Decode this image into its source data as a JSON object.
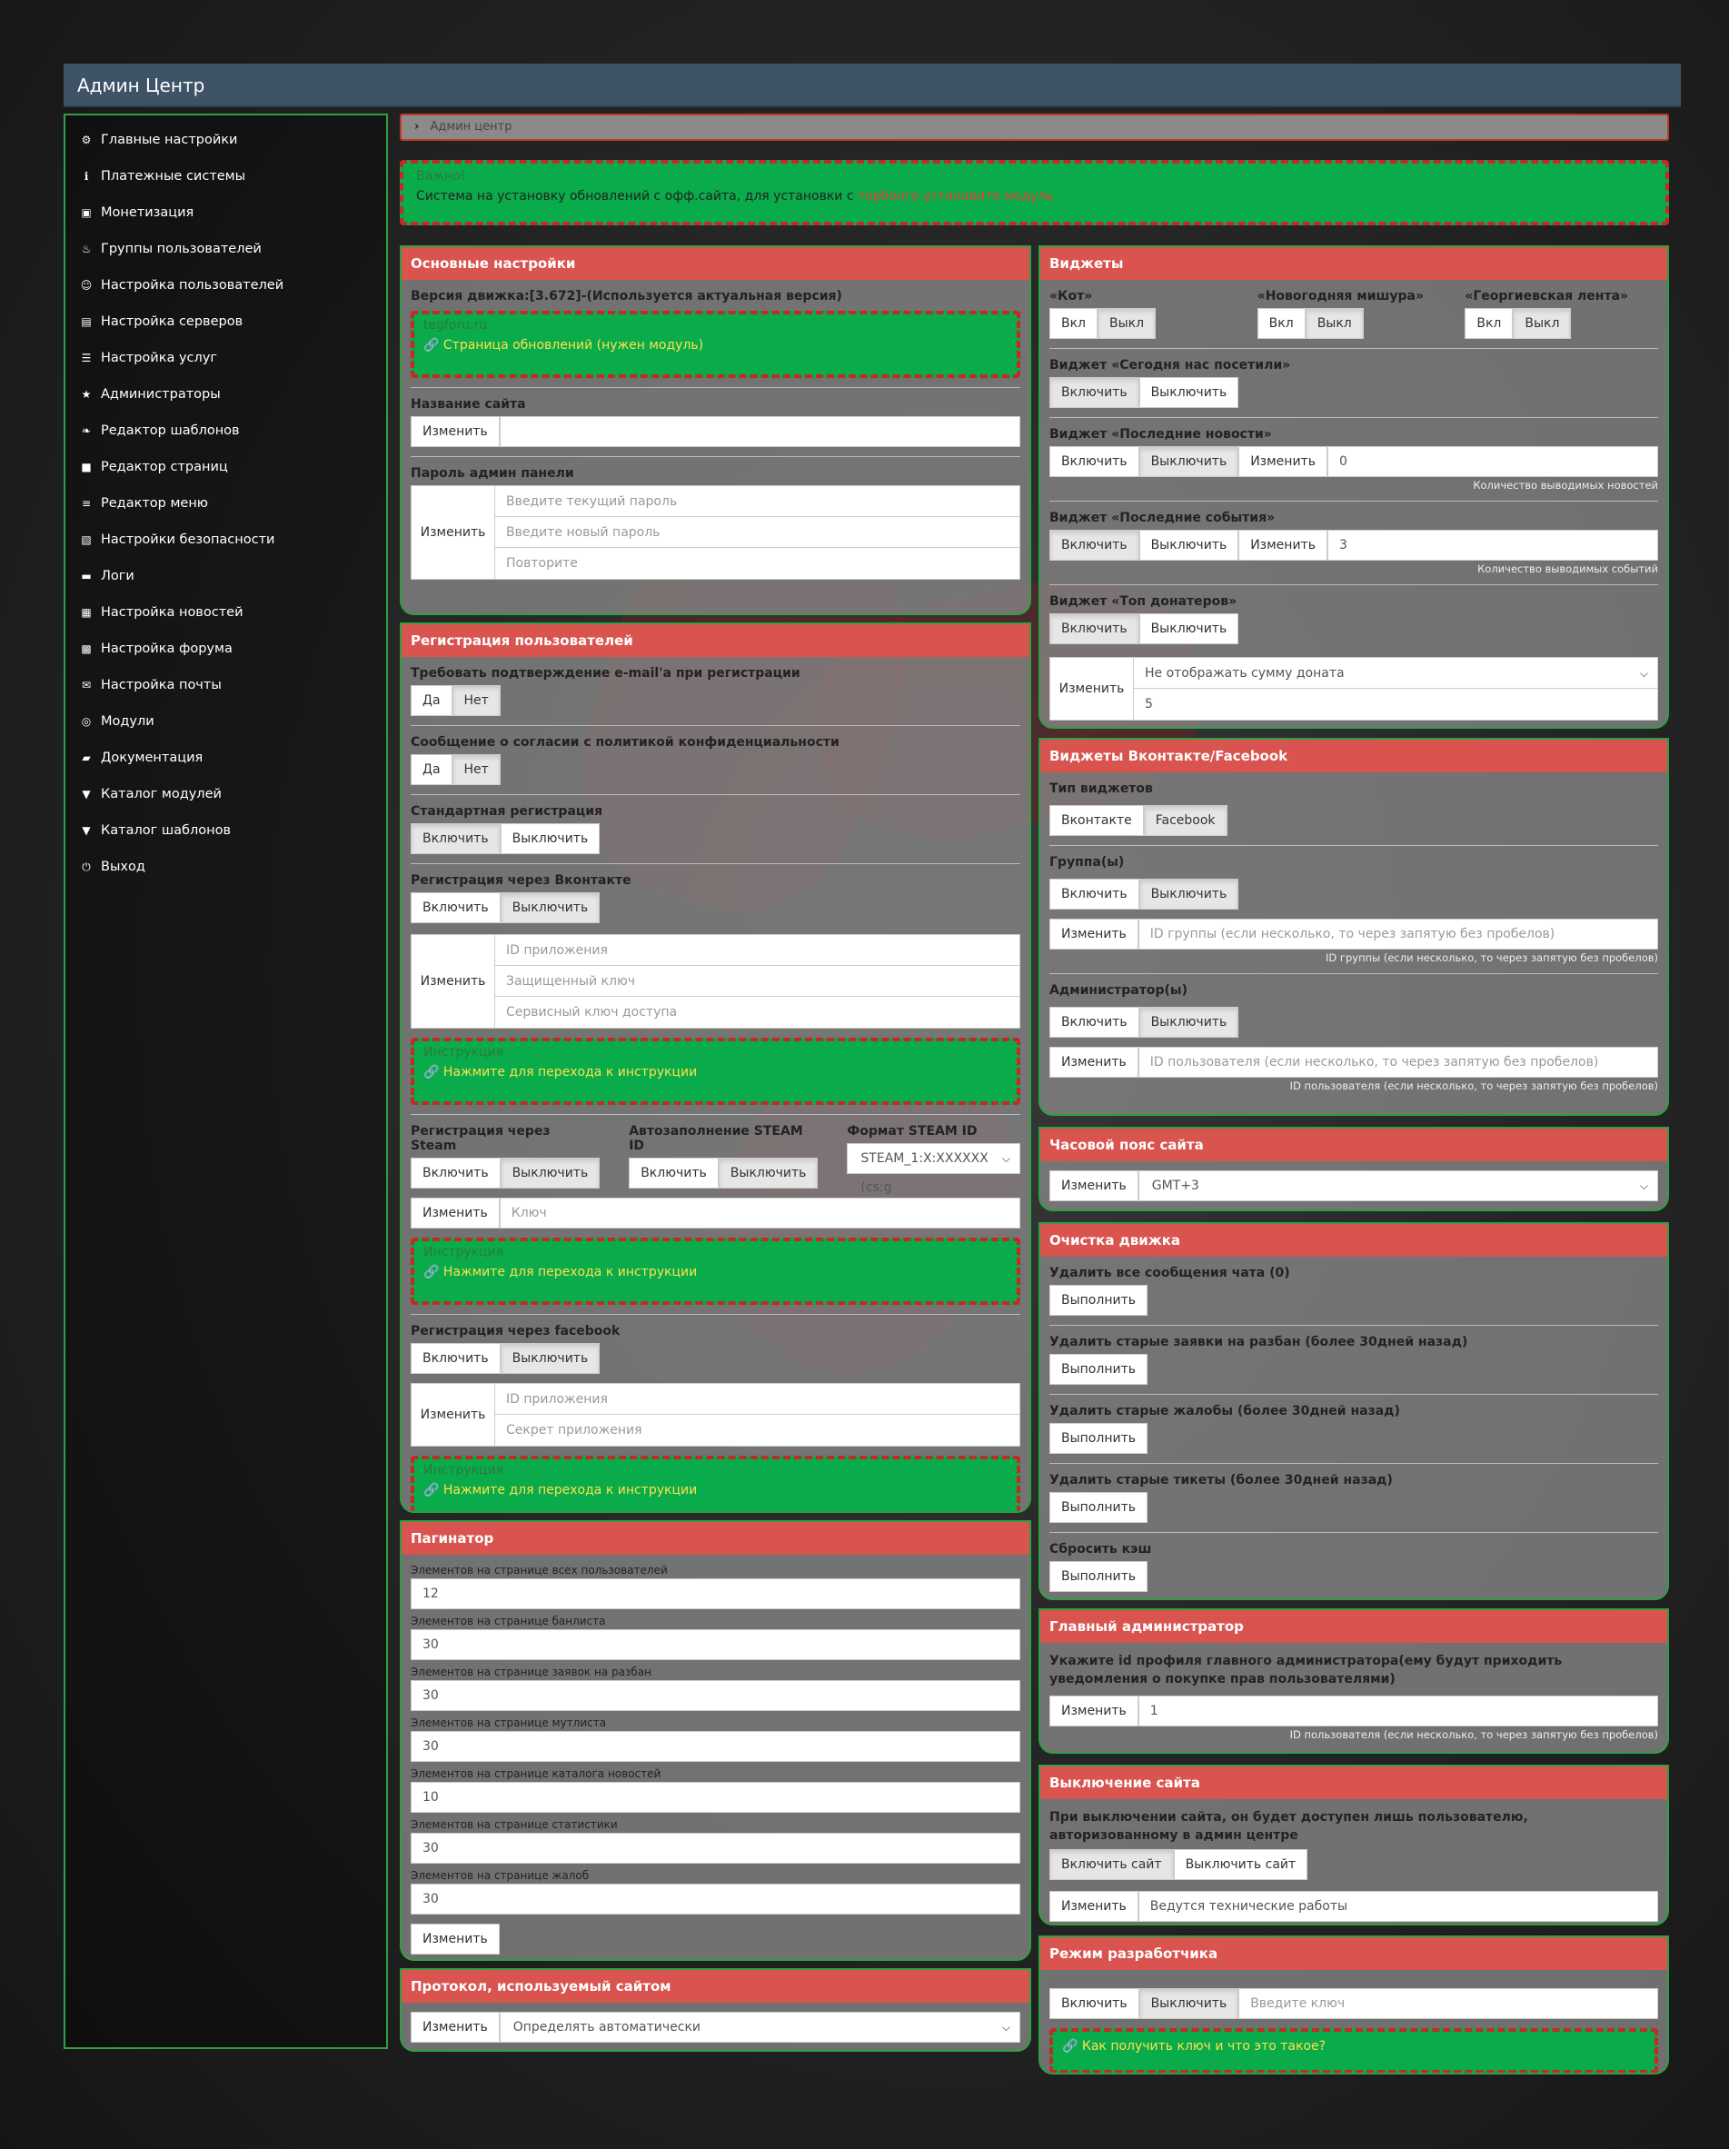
{
  "header": {
    "title": "Админ Центр"
  },
  "sidebar": {
    "items": [
      {
        "label": "Главные настройки",
        "icon": "gear-icon"
      },
      {
        "label": "Платежные системы",
        "icon": "info-icon"
      },
      {
        "label": "Монетизация",
        "icon": "cubes-icon"
      },
      {
        "label": "Группы пользователей",
        "icon": "fire-icon"
      },
      {
        "label": "Настройка пользователей",
        "icon": "user-icon"
      },
      {
        "label": "Настройка серверов",
        "icon": "server-icon"
      },
      {
        "label": "Настройка услуг",
        "icon": "bars-icon"
      },
      {
        "label": "Администраторы",
        "icon": "star-icon"
      },
      {
        "label": "Редактор шаблонов",
        "icon": "leaf-icon"
      },
      {
        "label": "Редактор страниц",
        "icon": "file-icon"
      },
      {
        "label": "Редактор меню",
        "icon": "list-icon"
      },
      {
        "label": "Настройки безопасности",
        "icon": "lock-icon"
      },
      {
        "label": "Логи",
        "icon": "logs-icon"
      },
      {
        "label": "Настройка новостей",
        "icon": "news-icon"
      },
      {
        "label": "Настройка форума",
        "icon": "forum-icon"
      },
      {
        "label": "Настройка почты",
        "icon": "mail-icon"
      },
      {
        "label": "Модули",
        "icon": "module-icon"
      },
      {
        "label": "Документация",
        "icon": "folder-icon"
      },
      {
        "label": "Каталог модулей",
        "icon": "cart-icon"
      },
      {
        "label": "Каталог шаблонов",
        "icon": "cart-icon"
      },
      {
        "label": "Выход",
        "icon": "power-icon"
      }
    ]
  },
  "breadcrumb": {
    "text": "Админ центр"
  },
  "notice": {
    "title": "Важно!",
    "text": "Система на установку обновлений с офф.сайта, для установки с ",
    "link": "торбонго установите модуль"
  },
  "basic": {
    "title": "Основные настройки",
    "version": "Версия движка:[3.672]-(Используется актуальная версия)",
    "box_title": "tegforu.ru",
    "box_link": "Страница обновлений (нужен модуль)",
    "site_name_label": "Название сайта",
    "change": "Изменить",
    "password_label": "Пароль админ панели",
    "pw_current": "Введите текущий пароль",
    "pw_new": "Введите новый пароль",
    "pw_repeat": "Повторите"
  },
  "reg": {
    "title": "Регистрация пользователей",
    "email_label": "Требовать подтверждение e-mail'а при регистрации",
    "yes": "Да",
    "no": "Нет",
    "privacy_label": "Сообщение о согласии с политикой конфиденциальности",
    "standard_label": "Стандартная регистрация",
    "enable": "Включить",
    "disable": "Выключить",
    "vk_label": "Регистрация через Вконтакте",
    "app_id": "ID приложения",
    "secure_key": "Защищенный ключ",
    "service_key": "Сервисный ключ доступа",
    "instr_title": "Инструкция",
    "instr_link": "Нажмите для перехода к инструкции",
    "steam_label": "Регистрация через Steam",
    "autofill_label": "Автозаполнение STEAM ID",
    "format_label": "Формат STEAM ID",
    "format_value": "STEAM_1:X:XXXXXX (cs:g",
    "key_placeholder": "Ключ",
    "fb_label": "Регистрация через facebook",
    "app_secret": "Секрет приложения",
    "change": "Изменить"
  },
  "paginator": {
    "title": "Пагинатор",
    "fields": [
      {
        "label": "Элементов на странице всех пользователей",
        "value": "12"
      },
      {
        "label": "Элементов на странице банлиста",
        "value": "30"
      },
      {
        "label": "Элементов на странице заявок на разбан",
        "value": "30"
      },
      {
        "label": "Элементов на странице мутлиста",
        "value": "30"
      },
      {
        "label": "Элементов на странице каталога новостей",
        "value": "10"
      },
      {
        "label": "Элементов на странице статистики",
        "value": "30"
      },
      {
        "label": "Элементов на странице жалоб",
        "value": "30"
      }
    ],
    "change": "Изменить"
  },
  "protocol": {
    "title": "Протокол, используемый сайтом",
    "change": "Изменить",
    "value": "Определять автоматически"
  },
  "widgets": {
    "title": "Виджеты",
    "cat": "«Кот»",
    "tinsel": "«Новогодняя мишура»",
    "ribbon": "«Георгиевская лента»",
    "on": "Вкл",
    "off": "Выкл",
    "visitors": "Виджет «Сегодня нас посетили»",
    "news": "Виджет «Последние новости»",
    "events": "Виджет «Последние события»",
    "donators": "Виджет «Топ донатеров»",
    "enable": "Включить",
    "disable": "Выключить",
    "change": "Изменить",
    "news_count": "0",
    "news_hint": "Количество выводимых новостей",
    "events_count": "3",
    "events_hint": "Количество выводимых событий",
    "donate_select": "Не отображать сумму доната",
    "donate_count": "5"
  },
  "social": {
    "title": "Виджеты Вконтакте/Facebook",
    "type_label": "Тип виджетов",
    "vk": "Вконтакте",
    "fb": "Facebook",
    "groups_label": "Группа(ы)",
    "enable": "Включить",
    "disable": "Выключить",
    "change": "Изменить",
    "group_placeholder": "ID группы (если несколько, то через запятую без пробелов)",
    "group_hint": "ID группы (если несколько, то через запятую без пробелов)",
    "admins_label": "Администратор(ы)",
    "user_placeholder": "ID пользователя (если несколько, то через запятую без пробелов)",
    "user_hint": "ID пользователя (если несколько, то через запятую без пробелов)"
  },
  "timezone": {
    "title": "Часовой пояс сайта",
    "change": "Изменить",
    "value": "GMT+3"
  },
  "cleanup": {
    "title": "Очистка движка",
    "run": "Выполнить",
    "items": [
      "Удалить все сообщения чата (0)",
      "Удалить старые заявки на разбан (более 30дней назад)",
      "Удалить старые жалобы (более 30дней назад)",
      "Удалить старые тикеты (более 30дней назад)",
      "Сбросить кэш"
    ]
  },
  "mainadmin": {
    "title": "Главный администратор",
    "text": "Укажите id профиля главного администратора(ему будут приходить уведомления о покупке прав пользователями)",
    "change": "Изменить",
    "value": "1",
    "hint": "ID пользователя (если несколько, то через запятую без пробелов)"
  },
  "shutdown": {
    "title": "Выключение сайта",
    "text": "При выключении сайта, он будет доступен лишь пользователю, авторизованному в админ центре",
    "on": "Включить сайт",
    "off": "Выключить сайт",
    "change": "Изменить",
    "value": "Ведутся технические работы"
  },
  "devmode": {
    "title": "Режим разработчика",
    "enable": "Включить",
    "disable": "Выключить",
    "key_placeholder": "Введите ключ",
    "link": "Как получить ключ и что это такое?"
  }
}
